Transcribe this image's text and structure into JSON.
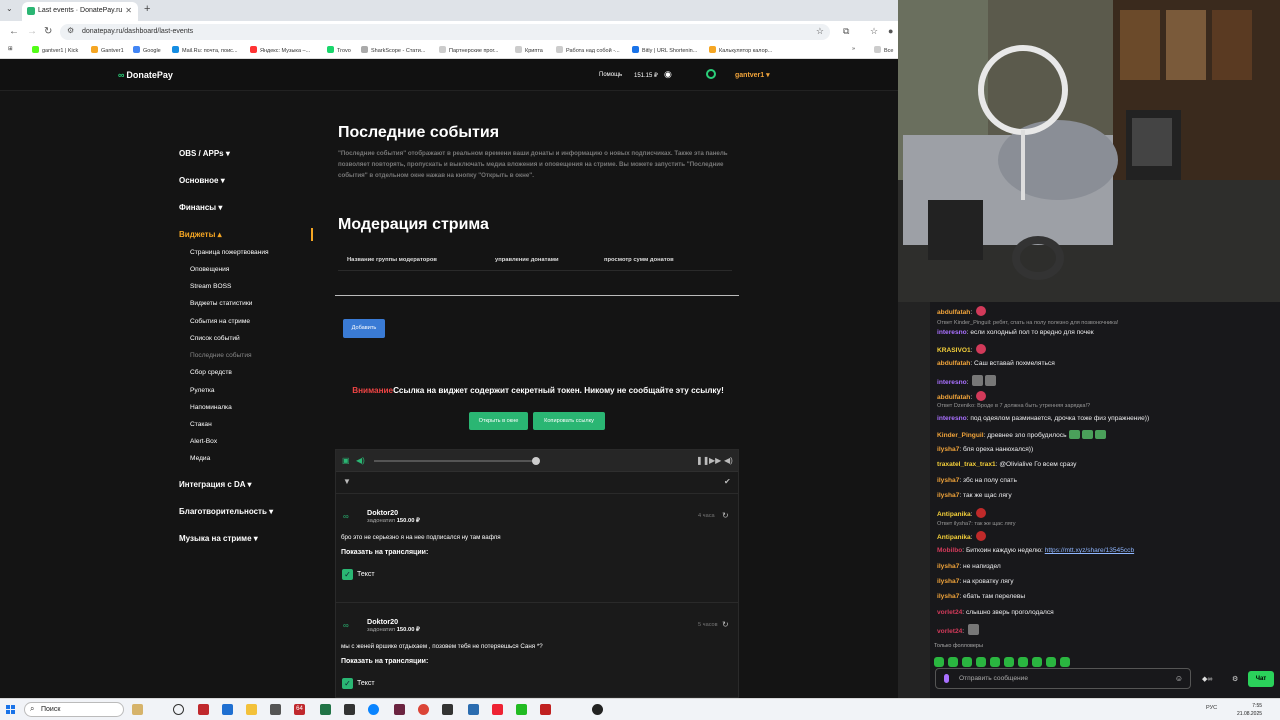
{
  "browser": {
    "tab_title": "Last events · DonatePay.ru",
    "url": "donatepay.ru/dashboard/last-events",
    "bookmarks": [
      "gantver1 | Kick",
      "Gantver1",
      "Google",
      "Mail.Ru: почта, поис...",
      "Яндекс: Музыка –...",
      "Trovo",
      "SharkScope - Стати...",
      "Партнерские прог...",
      "Крипта",
      "Работа над собой -...",
      "Bitly | URL Shortenin...",
      "Калькулятор калор...",
      "Все"
    ]
  },
  "site": {
    "logo": "DonatePay",
    "help": "Помощь",
    "balance": "151.15 ₽",
    "username": "gantver1 ▾"
  },
  "sidebar": {
    "sections": [
      {
        "label": "OBS / APPs ▾"
      },
      {
        "label": "Основное ▾"
      },
      {
        "label": "Финансы ▾"
      },
      {
        "label": "Виджеты ▴"
      },
      {
        "label": "Интеграция с DA ▾"
      },
      {
        "label": "Благотворительность ▾"
      },
      {
        "label": "Музыка на стриме ▾"
      }
    ],
    "widget_items": [
      "Страница пожертвования",
      "Оповещения",
      "Stream BOSS",
      "Виджеты статистики",
      "События на стриме",
      "Список событий",
      "Последние события",
      "Сбор средств",
      "Рулетка",
      "Напоминалка",
      "Стакан",
      "Alert-Box",
      "Медиа"
    ]
  },
  "main": {
    "title": "Последние события",
    "description": "\"Последние события\" отображают в реальном времени ваши донаты и информацию о новых подписчиках. Также эта панель позволяет повторять, пропускать и выключать медиа вложения и оповещения на стриме. Вы можете запустить \"Последние события\" в отдельном окне нажав на кнопку \"Открыть в окне\".",
    "moderation_title": "Модерация стрима",
    "columns": [
      "Название группы модераторов",
      "управление донатами",
      "просмотр сумм донатов"
    ],
    "add_button": "Добавить",
    "warning_red": "Внимание",
    "warning_text": "Ссылка на виджет содержит секретный токен. Никому не сообщайте эту ссылку!",
    "open_window": "Открыть в окне",
    "copy_link": "Копировать ссылку"
  },
  "events": [
    {
      "name": "Doktor20",
      "donated_label": "задонатил",
      "amount": "150.00 ₽",
      "time": "4 часа",
      "message": "бро это не серьезно я на нее подписался ну там вафля",
      "show_label": "Показать на трансляции:",
      "checkbox_label": "Текст"
    },
    {
      "name": "Doktor20",
      "donated_label": "задонатил",
      "amount": "150.00 ₽",
      "time": "5 часов",
      "message": "мы с женей вршике отдыхаем , позовем тебя не потеряешься Саня *?",
      "show_label": "Показать на трансляции:",
      "checkbox_label": "Текст"
    }
  ],
  "chat": {
    "messages": [
      {
        "user": "abdulfatah",
        "text": "",
        "color": "#f0a33a",
        "emote": "pink"
      },
      {
        "reply": "Ответ Kinder_Pinguil: ребят, спать на полу полезно для позвоночника!"
      },
      {
        "user": "interesno",
        "text": "если холодный пол то вредно для почек",
        "color": "#a970ff"
      },
      {
        "user": "KRASIVO1",
        "text": "",
        "color": "#f5d03a",
        "emote": "pink"
      },
      {
        "user": "abdulfatah",
        "text": "Саш вставай похмеляться",
        "color": "#f0a33a"
      },
      {
        "user": "interesno",
        "text": "",
        "color": "#a970ff",
        "emote": "gray2"
      },
      {
        "user": "abdulfatah",
        "text": "",
        "color": "#f0a33a",
        "emote": "pink"
      },
      {
        "reply": "Ответ Dzeniko: Вроде в 7 должна быть утренняя зарядка!?"
      },
      {
        "user": "interesno",
        "text": "под одеялом разминается, дрочка тоже физ упражнение))",
        "color": "#a970ff"
      },
      {
        "user": "Kinder_Pinguil",
        "text": "древнее зло пробудилось",
        "color": "#f0a33a",
        "emote": "green3"
      },
      {
        "user": "ilysha7",
        "text": "бля ореха нанюхался))",
        "color": "#f0a33a"
      },
      {
        "user": "traxatel_trax_trax1",
        "text": "@Olivialive Го всем сразу",
        "color": "#f5d03a"
      },
      {
        "user": "ilysha7",
        "text": "збс на полу спать",
        "color": "#f0a33a"
      },
      {
        "user": "ilysha7",
        "text": "так же щас лягу",
        "color": "#f0a33a"
      },
      {
        "user": "Antipanika",
        "text": "",
        "color": "#f5d03a",
        "emote": "red"
      },
      {
        "reply": "Ответ ilysha7: так же щас лягу"
      },
      {
        "user": "Antipanika",
        "text": "",
        "color": "#f5d03a",
        "emote": "red"
      },
      {
        "user": "Mobilbo",
        "text": "Биткоин каждую неделю: ",
        "link": "https://mtt.xyz/share/13545ccb",
        "color": "#d23a5a"
      },
      {
        "user": "ilysha7",
        "text": "не напиздел",
        "color": "#f0a33a"
      },
      {
        "user": "ilysha7",
        "text": "на кроватку лягу",
        "color": "#f0a33a"
      },
      {
        "user": "ilysha7",
        "text": "ебать там перелевы",
        "color": "#f0a33a"
      },
      {
        "user": "vorlet24",
        "text": "слышно зверь проголодался",
        "color": "#d23a5a"
      },
      {
        "user": "vorlet24",
        "text": "",
        "color": "#d23a5a",
        "emote": "gray1"
      }
    ],
    "followers_only": "Только фолловеры",
    "input_placeholder": "Отправить сообщение",
    "send_button": "Чат"
  },
  "taskbar": {
    "search": "Поиск",
    "badge": "64",
    "lang": "РУС",
    "time": "7:55",
    "date": "21.08.2025"
  }
}
